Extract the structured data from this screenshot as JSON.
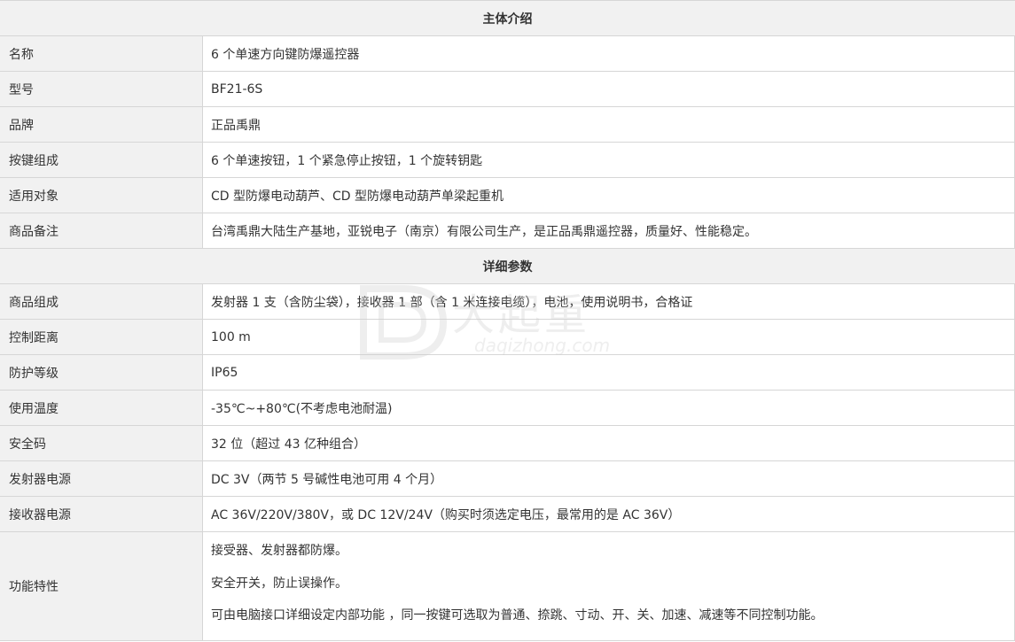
{
  "sections": {
    "intro_title": "主体介绍",
    "detail_title": "详细参数"
  },
  "intro_rows": [
    {
      "label": "名称",
      "value": "6 个单速方向键防爆遥控器"
    },
    {
      "label": "型号",
      "value": "BF21-6S"
    },
    {
      "label": "品牌",
      "value": "正品禹鼎"
    },
    {
      "label": "按键组成",
      "value": "6 个单速按钮，1 个紧急停止按钮，1 个旋转钥匙"
    },
    {
      "label": "适用对象",
      "value": "CD 型防爆电动葫芦、CD 型防爆电动葫芦单梁起重机"
    },
    {
      "label": "商品备注",
      "value": "台湾禹鼎大陆生产基地，亚锐电子（南京）有限公司生产，是正品禹鼎遥控器，质量好、性能稳定。"
    }
  ],
  "detail_rows": [
    {
      "label": "商品组成",
      "value": "发射器 1 支（含防尘袋），接收器 1 部（含 1 米连接电缆），电池，使用说明书，合格证"
    },
    {
      "label": "控制距离",
      "value": "100 m"
    },
    {
      "label": "防护等级",
      "value": "IP65"
    },
    {
      "label": "使用温度",
      "value": "-35℃~+80℃(不考虑电池耐温)"
    },
    {
      "label": "安全码",
      "value": "32 位（超过 43 亿种组合）"
    },
    {
      "label": "发射器电源",
      "value": "DC 3V（两节 5 号碱性电池可用 4 个月）"
    },
    {
      "label": "接收器电源",
      "value": "AC 36V/220V/380V，或 DC 12V/24V（购买时须选定电压，最常用的是 AC 36V）"
    }
  ],
  "features": {
    "label": "功能特性",
    "lines": [
      "接受器、发射器都防爆。",
      "安全开关，防止误操作。",
      "可由电脑接口详细设定内部功能 ，同一按键可选取为普通、捺跳、寸动、开、关、加速、减速等不同控制功能。"
    ]
  },
  "watermark": {
    "brand": "大起重",
    "domain": "daqizhong.com"
  }
}
